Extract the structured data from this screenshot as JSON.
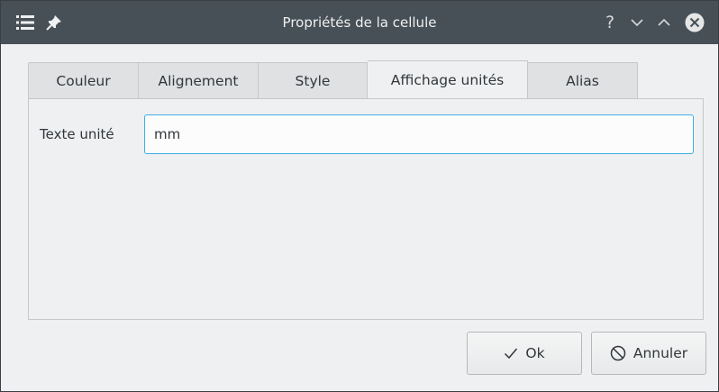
{
  "window": {
    "title": "Propriétés de la cellule",
    "help_glyph": "?",
    "minimize_glyph": "⌄",
    "maximize_glyph": "⌃"
  },
  "tabs": [
    {
      "label": "Couleur",
      "active": false
    },
    {
      "label": "Alignement",
      "active": false
    },
    {
      "label": "Style",
      "active": false
    },
    {
      "label": "Affichage unités",
      "active": true
    },
    {
      "label": "Alias",
      "active": false
    }
  ],
  "unit_panel": {
    "label": "Texte unité",
    "value": "mm"
  },
  "buttons": {
    "ok_label": "Ok",
    "cancel_label": "Annuler"
  },
  "colors": {
    "titlebar": "#475057",
    "focus_border": "#3daee9",
    "close_circle": "#e6e6e6"
  },
  "icons": {
    "menu": "menu-icon",
    "pin": "pin-icon",
    "close": "close-icon",
    "ok": "check-icon",
    "cancel": "cancel-icon"
  }
}
